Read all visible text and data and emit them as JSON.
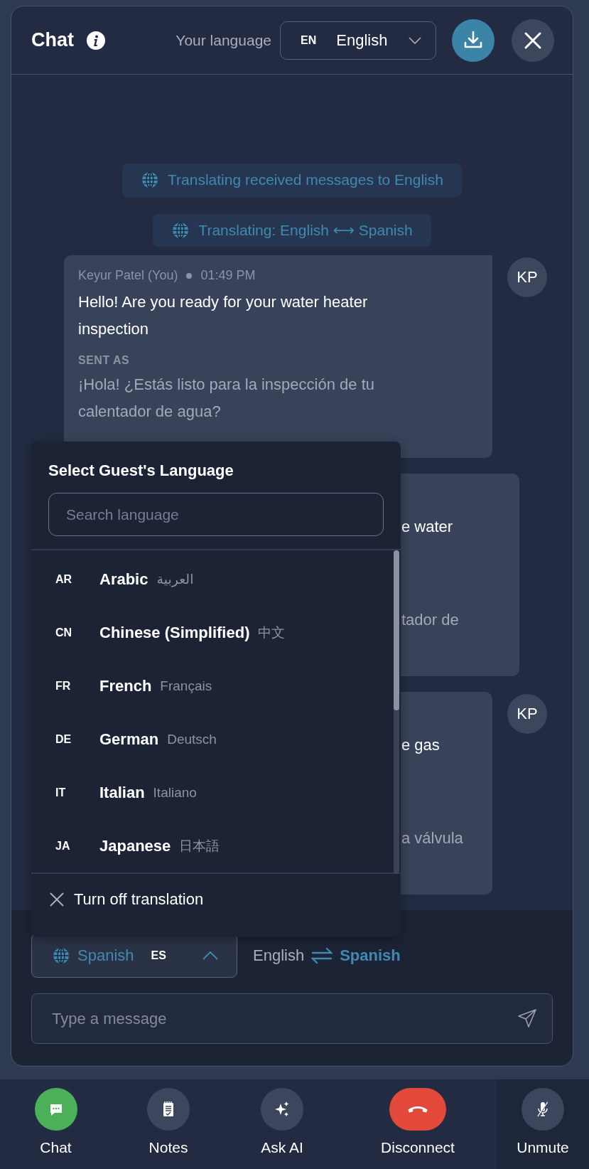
{
  "header": {
    "title": "Chat",
    "language_label": "Your language",
    "language_code": "EN",
    "language_name": "English"
  },
  "banners": [
    {
      "text": "Translating received messages to English"
    },
    {
      "text": "Translating: English ⟷ Spanish"
    }
  ],
  "messages": [
    {
      "kind": "full",
      "sender": "Keyur Patel (You)",
      "time": "01:49 PM",
      "avatar": "KP",
      "text": "Hello! Are you ready for your water heater inspection",
      "sent_as_label": "SENT AS",
      "sent_as": "¡Hola! ¿Estás listo para la inspección de tu calentador de agua?"
    },
    {
      "kind": "partial",
      "lines": [
        "e water",
        "tador de"
      ]
    },
    {
      "kind": "partial",
      "avatar": "KP",
      "lines": [
        "e gas",
        "a válvula"
      ]
    }
  ],
  "language_menu": {
    "title": "Select Guest's Language",
    "search_placeholder": "Search language",
    "languages": [
      {
        "code": "AR",
        "name": "Arabic",
        "native": "العربية",
        "selected": false
      },
      {
        "code": "CN",
        "name": "Chinese (Simplified)",
        "native": "中文",
        "selected": false
      },
      {
        "code": "FR",
        "name": "French",
        "native": "Français",
        "selected": false
      },
      {
        "code": "DE",
        "name": "German",
        "native": "Deutsch",
        "selected": false
      },
      {
        "code": "IT",
        "name": "Italian",
        "native": "Italiano",
        "selected": false
      },
      {
        "code": "JA",
        "name": "Japanese",
        "native": "日本語",
        "selected": false
      }
    ],
    "footer": "Turn off translation"
  },
  "composer": {
    "language": {
      "name": "Spanish",
      "code": "ES",
      "expanded": true
    },
    "pair": {
      "from": "English",
      "to": "Spanish"
    },
    "placeholder": "Type a message"
  },
  "toolbar": [
    {
      "kind": "chat",
      "label": "Chat",
      "selected": true
    },
    {
      "kind": "notes",
      "label": "Notes",
      "selected": false
    },
    {
      "kind": "ai",
      "label": "Ask AI",
      "selected": false
    },
    {
      "kind": "disconnect",
      "label": "Disconnect",
      "selected": false
    },
    {
      "kind": "mute",
      "label": "Unmute",
      "selected": false
    }
  ]
}
